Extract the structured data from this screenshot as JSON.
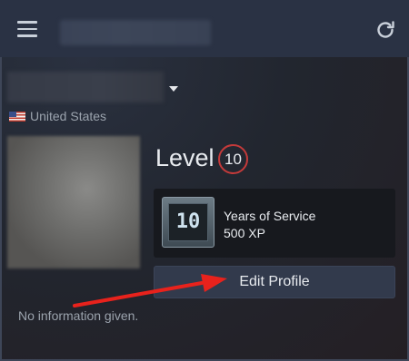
{
  "header": {
    "menu_icon": "hamburger-icon",
    "refresh_icon": "refresh-icon"
  },
  "profile": {
    "country": "United States",
    "level_label": "Level",
    "level_value": "10"
  },
  "badge": {
    "icon_text": "10",
    "name": "Years of Service",
    "xp": "500 XP"
  },
  "actions": {
    "edit_profile_label": "Edit Profile"
  },
  "summary": {
    "text": "No information given."
  },
  "colors": {
    "header_bg": "#2a3244",
    "level_ring": "#c43a3a",
    "annotation_arrow": "#e8221c"
  }
}
